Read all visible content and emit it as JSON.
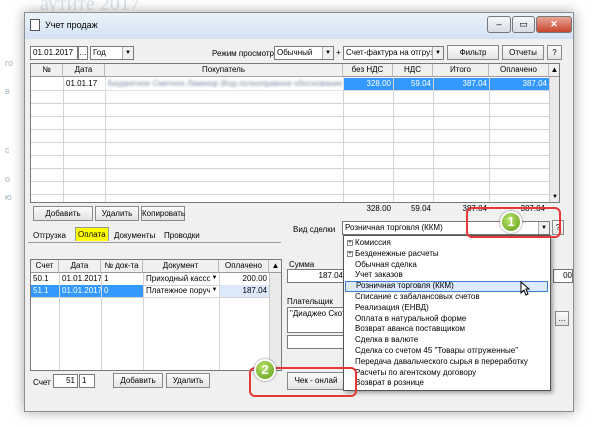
{
  "background": {
    "title": "аутите 2017",
    "left_chars": [
      "го",
      "в",
      "с",
      "о",
      "ю"
    ]
  },
  "window": {
    "title": "Учет продаж",
    "icon": "document-icon",
    "controls": [
      "minimize-icon",
      "maximize-icon",
      "close-icon"
    ]
  },
  "toolbar": {
    "date": "01.01.2017",
    "period": "Год",
    "mode_label": "Режим просмотра:",
    "mode_value": "Обычный",
    "plus": "+",
    "doc_type": "Счет-фактура на отгрузку",
    "filter_label": "Фильтр",
    "reports_label": "Отчеты",
    "help_label": "?"
  },
  "main_table": {
    "columns": [
      "№",
      "Дата",
      "Покупатель",
      "без НДС",
      "НДС",
      "Итого",
      "Оплачено"
    ],
    "rows": [
      {
        "num": "",
        "date": "01.01.17",
        "buyer": "Бюджетное Сметное Лакинор (Код полноправное обоснование ТК)",
        "net": "328.00",
        "vat": "59.04",
        "total": "387.04",
        "paid": "387.04"
      }
    ],
    "totals": {
      "net": "328.00",
      "vat": "59.04",
      "total": "387.04",
      "paid": "387.04"
    }
  },
  "row_buttons": {
    "add": "Добавить",
    "delete": "Удалить",
    "copy": "Копировать"
  },
  "tabs": [
    "Отгрузка",
    "Оплата",
    "Документы",
    "Проводки"
  ],
  "deal": {
    "label": "Вид сделки",
    "value": "Розничная торговля (ККМ)"
  },
  "payments_table": {
    "columns": [
      "Счет",
      "Дата",
      "№ док-та",
      "Документ",
      "Оплачено"
    ],
    "rows": [
      {
        "account": "50.1",
        "date": "01.01.2017",
        "doc_num": "1",
        "doc": "Приходный кассов",
        "paid": "200.00"
      },
      {
        "account": "51.1",
        "date": "01.01.2017",
        "doc_num": "0",
        "doc": "Платежное поруче",
        "paid": "187.04"
      }
    ]
  },
  "sum": {
    "label": "Сумма",
    "value": "187.04"
  },
  "payer": {
    "label": "Плательщик",
    "value": "\"Диаджео Скот"
  },
  "bottom": {
    "account_label": "Счет",
    "account": "51",
    "sub": "1",
    "add": "Добавить",
    "delete": "Удалить",
    "check": "Чек - онлай"
  },
  "deal_types": [
    {
      "label": "Комиссия",
      "expand": "+"
    },
    {
      "label": "Безденежные расчеты",
      "expand": "+"
    },
    {
      "label": "Обычная сделка"
    },
    {
      "label": "Учет заказов"
    },
    {
      "label": "Розничная торговля (ККМ)",
      "selected": true
    },
    {
      "label": "Списание с забалансовых счетов"
    },
    {
      "label": "Реализация (ЕНВД)"
    },
    {
      "label": "Оплата в натуральной форме"
    },
    {
      "label": "Возврат аванса поставщиком"
    },
    {
      "label": "Сделка в валюте"
    },
    {
      "label": "Сделка со счетом 45 \"Товары отгруженные\""
    },
    {
      "label": "Передача давальческого сырья в переработку"
    },
    {
      "label": "Расчеты по агентскому договору"
    },
    {
      "label": "Возврат в рознице"
    }
  ],
  "right_partial": {
    "field": "00",
    "ellipsis": "..."
  },
  "callouts": {
    "one": "1",
    "two": "2"
  }
}
